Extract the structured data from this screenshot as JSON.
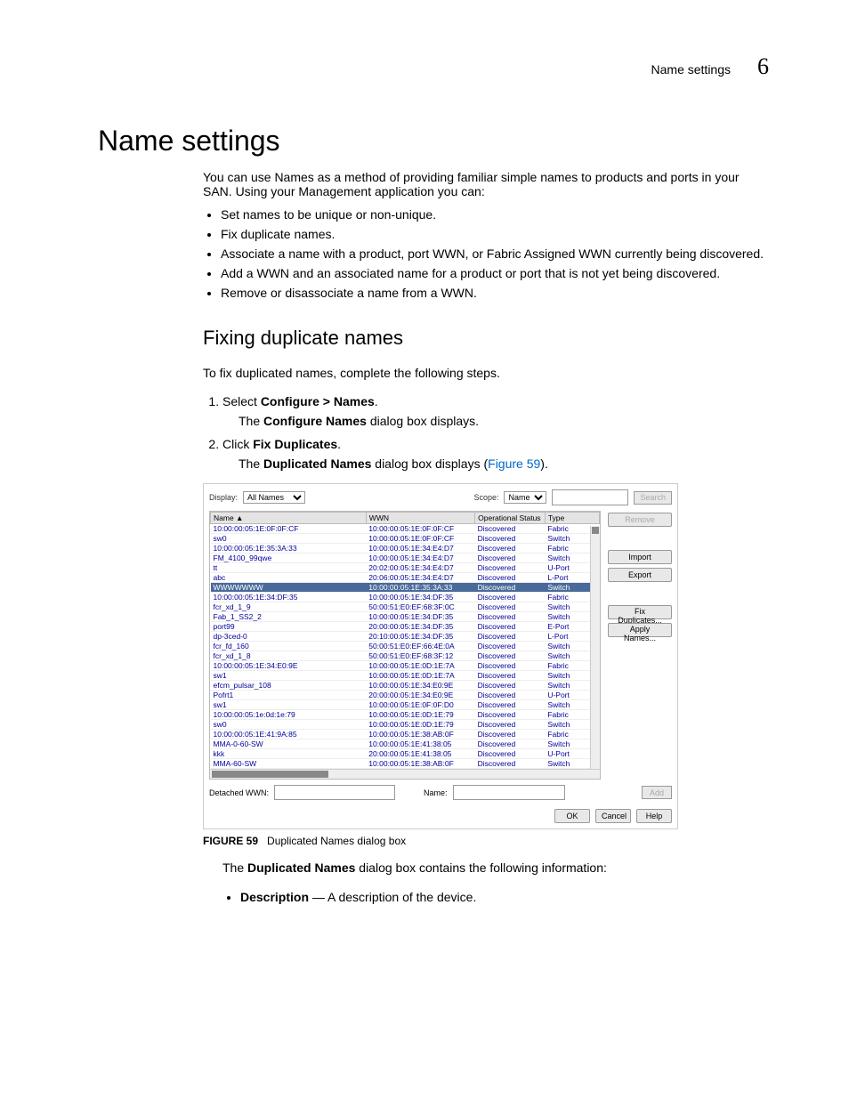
{
  "header": {
    "title": "Name settings",
    "chapter": "6"
  },
  "h1": "Name settings",
  "intro": "You can use Names as a method of providing familiar simple names to products and ports in your SAN. Using your Management application you can:",
  "bullets": [
    "Set names to be unique or non-unique.",
    "Fix duplicate names.",
    "Associate a name with a product, port WWN, or Fabric Assigned WWN currently being discovered.",
    "Add a WWN and an associated name for a product or port that is not yet being discovered.",
    "Remove or disassociate a name from a WWN."
  ],
  "h2": "Fixing duplicate names",
  "intro2": "To fix duplicated names, complete the following steps.",
  "steps": {
    "s1_a": "Select ",
    "s1_b": "Configure > Names",
    "s1_c": ".",
    "s1_sub_a": "The ",
    "s1_sub_b": "Configure Names",
    "s1_sub_c": " dialog box displays.",
    "s2_a": "Click ",
    "s2_b": "Fix Duplicates",
    "s2_c": ".",
    "s2_sub_a": "The ",
    "s2_sub_b": "Duplicated Names",
    "s2_sub_c": " dialog box displays (",
    "s2_sub_link": "Figure 59",
    "s2_sub_d": ")."
  },
  "dialog": {
    "display_label": "Display:",
    "display_value": "All Names",
    "scope_label": "Scope:",
    "scope_value": "Name",
    "search_btn": "Search",
    "columns": {
      "c1": "Name ▲",
      "c2": "WWN",
      "c3": "Operational Status",
      "c4": "Type"
    },
    "rows": [
      {
        "n": "10:00:00:05:1E:0F:0F:CF",
        "w": "10:00:00:05:1E:0F:0F:CF",
        "s": "Discovered",
        "t": "Fabric"
      },
      {
        "n": "sw0",
        "w": "10:00:00:05:1E:0F:0F:CF",
        "s": "Discovered",
        "t": "Switch"
      },
      {
        "n": "10:00:00:05:1E:35:3A:33",
        "w": "10:00:00:05:1E:34:E4:D7",
        "s": "Discovered",
        "t": "Fabric"
      },
      {
        "n": "FM_4100_99qwe",
        "w": "10:00:00:05:1E:34:E4:D7",
        "s": "Discovered",
        "t": "Switch"
      },
      {
        "n": "tt",
        "w": "20:02:00:05:1E:34:E4:D7",
        "s": "Discovered",
        "t": "U-Port"
      },
      {
        "n": "abc",
        "w": "20:06:00:05:1E:34:E4:D7",
        "s": "Discovered",
        "t": "L-Port"
      },
      {
        "n": "WWWWWWW",
        "w": "10:00:00:05:1E:35:3A:33",
        "s": "Discovered",
        "t": "Switch",
        "sel": true
      },
      {
        "n": "10:00:00:05:1E:34:DF:35",
        "w": "10:00:00:05:1E:34:DF:35",
        "s": "Discovered",
        "t": "Fabric"
      },
      {
        "n": "fcr_xd_1_9",
        "w": "50:00:51:E0:EF:68:3F:0C",
        "s": "Discovered",
        "t": "Switch"
      },
      {
        "n": "Fab_1_SS2_2",
        "w": "10:00:00:05:1E:34:DF:35",
        "s": "Discovered",
        "t": "Switch"
      },
      {
        "n": "port99",
        "w": "20:00:00:05:1E:34:DF:35",
        "s": "Discovered",
        "t": "E-Port"
      },
      {
        "n": "dp-3ced-0",
        "w": "20:10:00:05:1E:34:DF:35",
        "s": "Discovered",
        "t": "L-Port"
      },
      {
        "n": "fcr_fd_160",
        "w": "50:00:51:E0:EF:66:4E:0A",
        "s": "Discovered",
        "t": "Switch"
      },
      {
        "n": "fcr_xd_1_8",
        "w": "50:00:51:E0:EF:68:3F:12",
        "s": "Discovered",
        "t": "Switch"
      },
      {
        "n": "10:00:00:05:1E:34:E0:9E",
        "w": "10:00:00:05:1E:0D:1E:7A",
        "s": "Discovered",
        "t": "Fabric"
      },
      {
        "n": "sw1",
        "w": "10:00:00:05:1E:0D:1E:7A",
        "s": "Discovered",
        "t": "Switch"
      },
      {
        "n": "efcm_pulsar_108",
        "w": "10:00:00:05:1E:34:E0:9E",
        "s": "Discovered",
        "t": "Switch"
      },
      {
        "n": "Pofrt1",
        "w": "20:00:00:05:1E:34:E0:9E",
        "s": "Discovered",
        "t": "U-Port"
      },
      {
        "n": "sw1",
        "w": "10:00:00:05:1E:0F:0F:D0",
        "s": "Discovered",
        "t": "Switch"
      },
      {
        "n": "10:00:00:05:1e:0d:1e:79",
        "w": "10:00:00:05:1E:0D:1E:79",
        "s": "Discovered",
        "t": "Fabric"
      },
      {
        "n": "sw0",
        "w": "10:00:00:05:1E:0D:1E:79",
        "s": "Discovered",
        "t": "Switch"
      },
      {
        "n": "10:00:00:05:1E:41:9A:85",
        "w": "10:00:00:05:1E:38:AB:0F",
        "s": "Discovered",
        "t": "Fabric"
      },
      {
        "n": "MMA-0-60-SW",
        "w": "10:00:00:05:1E:41:38:05",
        "s": "Discovered",
        "t": "Switch"
      },
      {
        "n": "kkk",
        "w": "20:00:00:05:1E:41:38:05",
        "s": "Discovered",
        "t": "U-Port"
      },
      {
        "n": "MMA-60-SW",
        "w": "10:00:00:05:1E:38:AB:0F",
        "s": "Discovered",
        "t": "Switch"
      }
    ],
    "side_buttons": {
      "remove": "Remove",
      "import": "Import",
      "export": "Export",
      "fix": "Fix Duplicates...",
      "apply": "Apply Names..."
    },
    "detached_label": "Detached WWN:",
    "name_field_label": "Name:",
    "add_btn": "Add",
    "ok": "OK",
    "cancel": "Cancel",
    "help": "Help"
  },
  "fig_caption": {
    "label": "FIGURE 59",
    "text": "Duplicated Names dialog box"
  },
  "post_fig_a": "The ",
  "post_fig_b": "Duplicated Names",
  "post_fig_c": " dialog box contains the following information:",
  "bullet2_a": "Description",
  "bullet2_b": " — A description of the device."
}
